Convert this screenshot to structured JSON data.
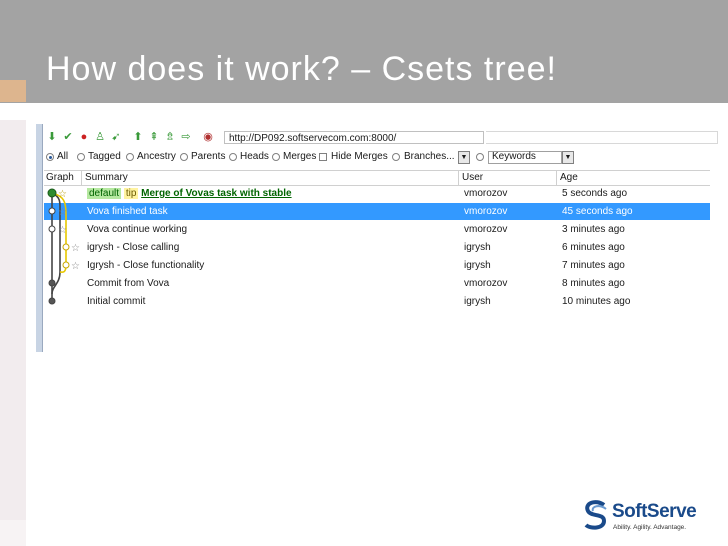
{
  "slide": {
    "title": "How does it work? – Csets tree!"
  },
  "toolbar": {
    "url": "http://DP092.softservecom.com:8000/",
    "icons": [
      "arrow-down-green-icon",
      "checkmark-icon",
      "stop-icon",
      "person-icon",
      "forward-icon",
      "arrow-up-icon",
      "incoming-icon",
      "push-icon",
      "pull-icon",
      "stop-red-icon"
    ]
  },
  "filters": {
    "all": "All",
    "tagged": "Tagged",
    "ancestry": "Ancestry",
    "parents": "Parents",
    "heads": "Heads",
    "merges": "Merges",
    "hide_merges": "Hide Merges",
    "branches": "Branches...",
    "keywords": "Keywords",
    "selected": "All"
  },
  "columns": {
    "graph": "Graph",
    "summary": "Summary",
    "user": "User",
    "age": "Age"
  },
  "rows": [
    {
      "tag_default": "default",
      "tag_tip": "tip",
      "summary": "Merge of Vovas task with stable",
      "user": "vmorozov",
      "age": "5 seconds ago"
    },
    {
      "summary": "Vova finished task",
      "user": "vmorozov",
      "age": "45 seconds ago"
    },
    {
      "summary": "Vova continue working",
      "user": "vmorozov",
      "age": "3 minutes ago"
    },
    {
      "summary": "igrysh - Close calling",
      "user": "igrysh",
      "age": "6 minutes ago"
    },
    {
      "summary": "Igrysh - Close functionality",
      "user": "igrysh",
      "age": "7 minutes ago"
    },
    {
      "summary": "Commit from Vova",
      "user": "vmorozov",
      "age": "8 minutes ago"
    },
    {
      "summary": "Initial commit",
      "user": "igrysh",
      "age": "10 minutes ago"
    }
  ],
  "selected_row": 1,
  "logo": {
    "name": "SoftServe",
    "tagline": "Ability. Agility. Advantage."
  },
  "colors": {
    "title_bar": "#a3a3a3",
    "selection": "#3399ff",
    "branch_default": "#2e8b2e",
    "branch_yellow": "#e8c800",
    "brand_blue": "#1a4a8a"
  }
}
